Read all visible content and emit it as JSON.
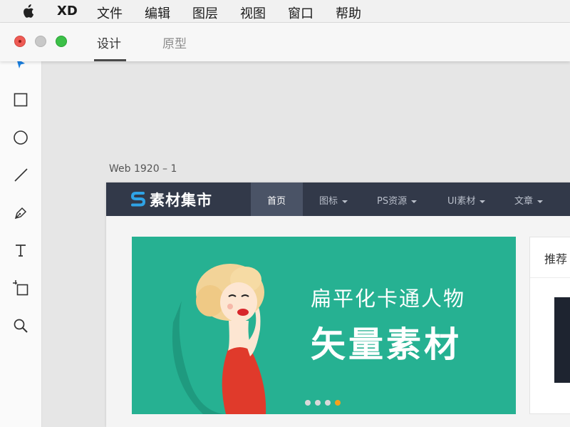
{
  "menubar": {
    "app_name": "XD",
    "items": [
      "文件",
      "编辑",
      "图层",
      "视图",
      "窗口",
      "帮助"
    ]
  },
  "tabs": [
    {
      "label": "设计",
      "active": true
    },
    {
      "label": "原型",
      "active": false
    }
  ],
  "tools": [
    "select-icon",
    "rectangle-icon",
    "ellipse-icon",
    "line-icon",
    "pen-icon",
    "text-icon",
    "artboard-icon",
    "zoom-icon"
  ],
  "canvas": {
    "artboard_label": "Web 1920 – 1"
  },
  "website": {
    "logo_text": "素材集市",
    "nav": [
      {
        "label": "首页",
        "active": true,
        "dropdown": false
      },
      {
        "label": "图标",
        "active": false,
        "dropdown": true
      },
      {
        "label": "PS资源",
        "active": false,
        "dropdown": true
      },
      {
        "label": "UI素材",
        "active": false,
        "dropdown": true
      },
      {
        "label": "文章",
        "active": false,
        "dropdown": true
      }
    ],
    "banner": {
      "subtitle": "扁平化卡通人物",
      "title": "矢量素材",
      "slides": 4,
      "active_slide": 4
    },
    "recommend_title": "推荐"
  },
  "colors": {
    "nav_bg": "#323949",
    "nav_active": "#4a5366",
    "banner_bg": "#26b192",
    "dot_active": "#f5a11c",
    "logo_blue": "#2fa3e6",
    "select_blue": "#1a7fe0"
  }
}
